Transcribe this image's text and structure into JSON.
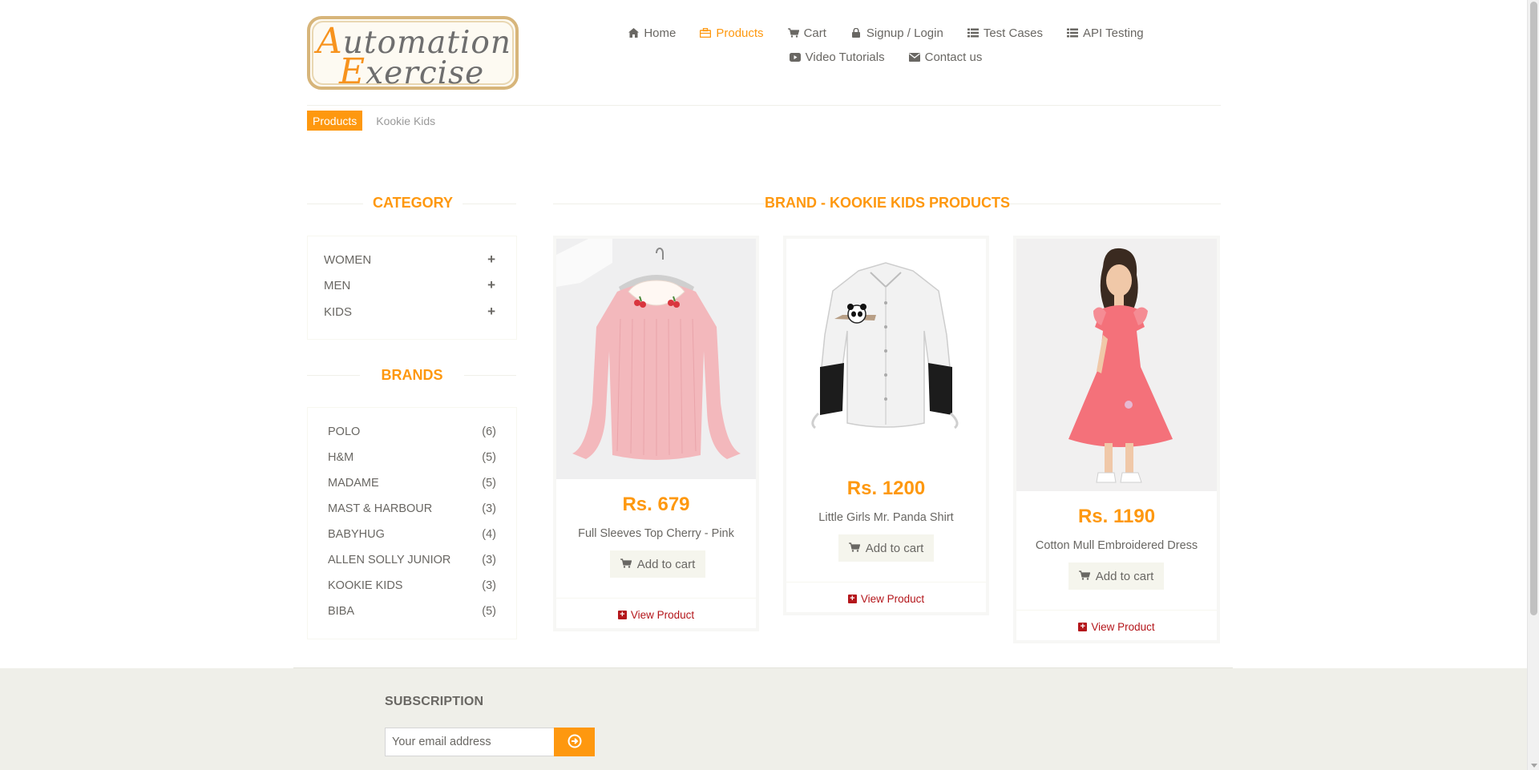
{
  "header": {
    "logo": {
      "line1_cap": "A",
      "line1_rest": "utomation",
      "line2_cap": "E",
      "line2_rest": "xercise"
    },
    "nav_row1": [
      {
        "label": "Home",
        "icon": "home-icon"
      },
      {
        "label": "Products",
        "icon": "products-icon",
        "active": true
      },
      {
        "label": "Cart",
        "icon": "cart-icon"
      },
      {
        "label": "Signup / Login",
        "icon": "lock-icon"
      },
      {
        "label": "Test Cases",
        "icon": "list-icon"
      },
      {
        "label": "API Testing",
        "icon": "list-icon"
      }
    ],
    "nav_row2": [
      {
        "label": "Video Tutorials",
        "icon": "youtube-icon"
      },
      {
        "label": "Contact us",
        "icon": "envelope-icon"
      }
    ]
  },
  "breadcrumb": {
    "active": "Products",
    "current": "Kookie Kids"
  },
  "sidebar": {
    "category_title": "Category",
    "categories": [
      {
        "label": "WOMEN"
      },
      {
        "label": "MEN"
      },
      {
        "label": "KIDS"
      }
    ],
    "brands_title": "Brands",
    "brands": [
      {
        "label": "POLO",
        "count": "(6)"
      },
      {
        "label": "H&M",
        "count": "(5)"
      },
      {
        "label": "MADAME",
        "count": "(5)"
      },
      {
        "label": "MAST & HARBOUR",
        "count": "(3)"
      },
      {
        "label": "BABYHUG",
        "count": "(4)"
      },
      {
        "label": "ALLEN SOLLY JUNIOR",
        "count": "(3)"
      },
      {
        "label": "KOOKIE KIDS",
        "count": "(3)"
      },
      {
        "label": "BIBA",
        "count": "(5)"
      }
    ]
  },
  "main": {
    "title": "Brand - Kookie Kids Products",
    "products": [
      {
        "price": "Rs. 679",
        "name": "Full Sleeves Top Cherry - Pink",
        "add_label": "Add to cart",
        "view_label": "View Product"
      },
      {
        "price": "Rs. 1200",
        "name": "Little Girls Mr. Panda Shirt",
        "add_label": "Add to cart",
        "view_label": "View Product"
      },
      {
        "price": "Rs. 1190",
        "name": "Cotton Mull Embroidered Dress",
        "add_label": "Add to cart",
        "view_label": "View Product"
      }
    ]
  },
  "footer": {
    "subscription_title": "Subscription",
    "email_placeholder": "Your email address"
  },
  "colors": {
    "accent": "#fe980f",
    "text": "#696763",
    "view_link": "#b4161b",
    "footer_bg": "#efefe9"
  }
}
